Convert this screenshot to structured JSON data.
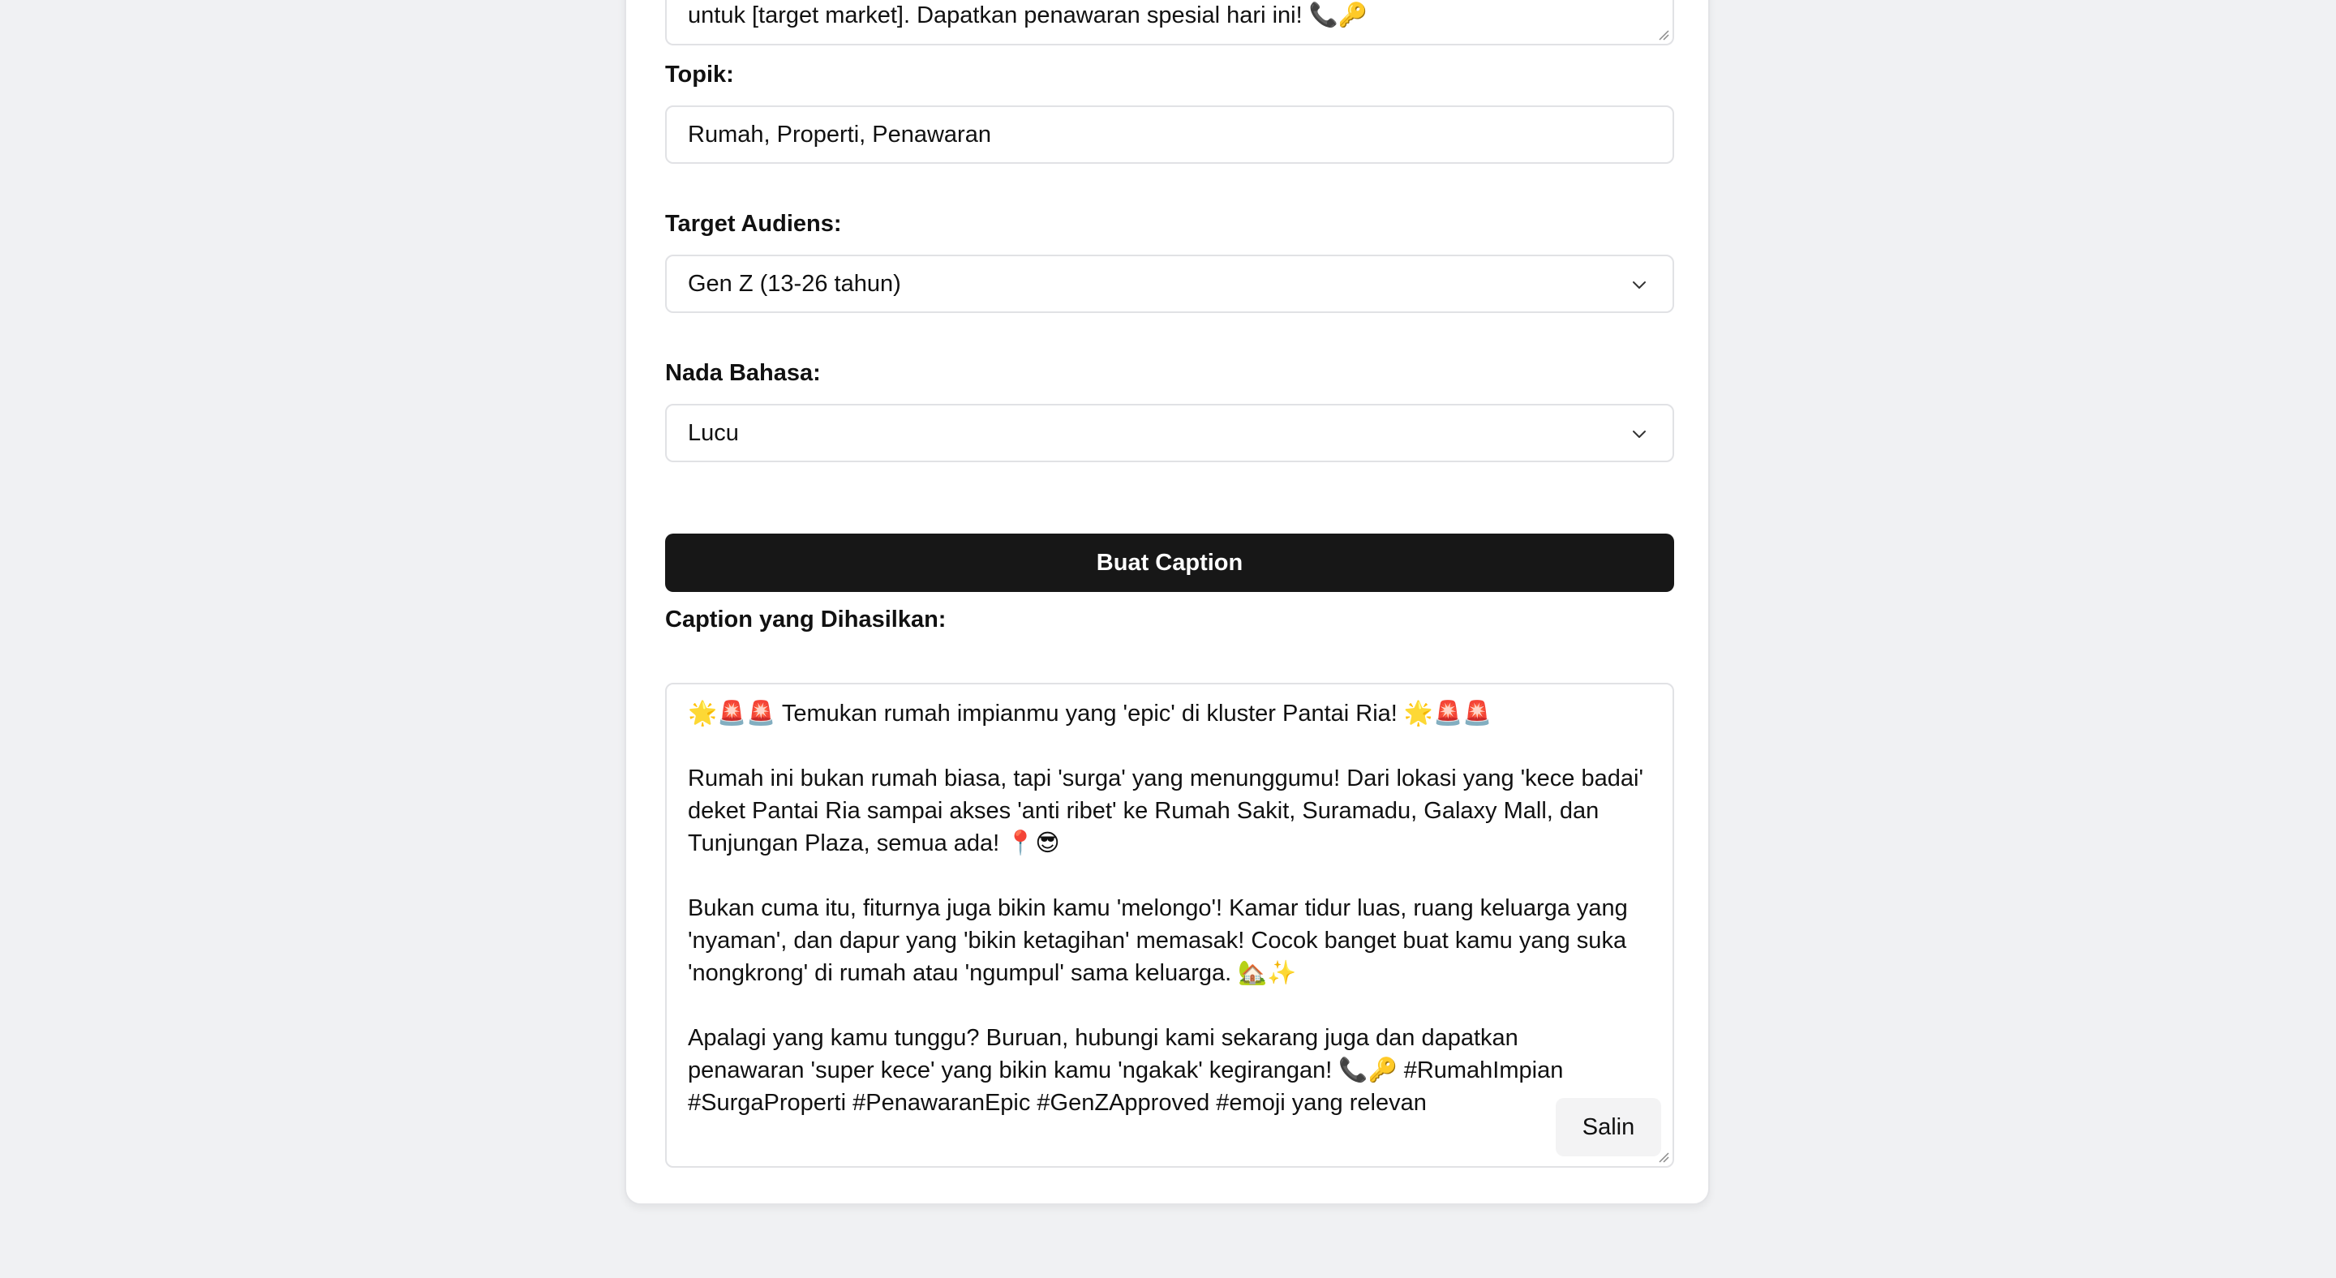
{
  "form": {
    "description_tail": "untuk [target market]. Dapatkan penawaran spesial hari ini! 📞🔑",
    "topic_label": "Topik:",
    "topic_value": "Rumah, Properti, Penawaran",
    "audience_label": "Target Audiens:",
    "audience_value": "Gen Z (13-26 tahun)",
    "tone_label": "Nada Bahasa:",
    "tone_value": "Lucu",
    "generate_button": "Buat Caption"
  },
  "output": {
    "label": "Caption yang Dihasilkan:",
    "paragraphs": [
      "🌟🚨🚨 Temukan rumah impianmu yang 'epic' di kluster Pantai Ria! 🌟🚨🚨",
      "Rumah ini bukan rumah biasa, tapi 'surga' yang menunggumu! Dari lokasi yang 'kece badai' deket Pantai Ria sampai akses 'anti ribet' ke Rumah Sakit, Suramadu, Galaxy Mall, dan Tunjungan Plaza, semua ada! 📍😎",
      "Bukan cuma itu, fiturnya juga bikin kamu 'melongo'! Kamar tidur luas, ruang keluarga yang 'nyaman', dan dapur yang 'bikin ketagihan' memasak! Cocok banget buat kamu yang suka 'nongkrong' di rumah atau 'ngumpul' sama keluarga. 🏡✨",
      "Apalagi yang kamu tunggu? Buruan, hubungi kami sekarang juga dan dapatkan penawaran 'super kece' yang bikin kamu 'ngakak' kegirangan! 📞🔑 #RumahImpian #SurgaProperti #PenawaranEpic #GenZApproved #emoji yang relevan"
    ],
    "copy_button": "Salin"
  },
  "icons": {
    "select_arrow": "chevron-down-icon",
    "resize_handle": "resize-grip-icon"
  },
  "colors": {
    "page_background": "#f0f1f3",
    "card_background": "#ffffff",
    "primary_button": "#171717",
    "border": "#e1e2e5"
  }
}
